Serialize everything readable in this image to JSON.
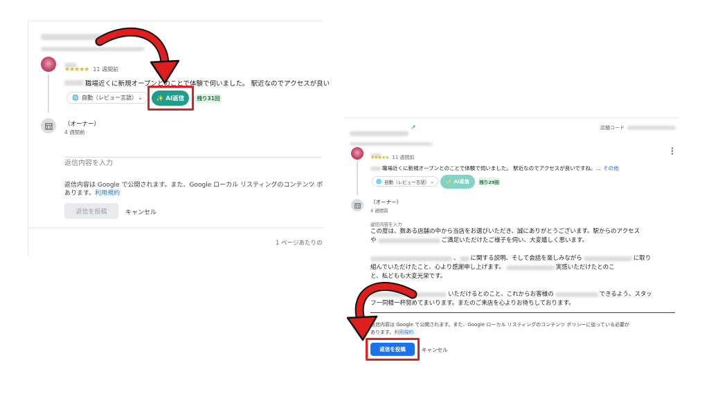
{
  "left_panel": {
    "stars": "★★★★★",
    "review_time": "11 週間前",
    "review_text": "職場近くに新規オープンとのことで体験で伺いました。 駅近なのでアクセスが良い",
    "lang_select": "自動（レビュー言語）",
    "ai_button": "✨ AI返信",
    "remaining": "残り31回",
    "owner_label": "（オーナー）",
    "owner_time": "4 週間前",
    "reply_placeholder": "返信内容を入力",
    "notice": "返信内容は Google で公開されます。また、Google ローカル リスティングのコンテンツ ポ",
    "notice_2": "あります。",
    "terms_link": "利用規約",
    "post_button": "返信を投稿",
    "cancel_button": "キャンセル",
    "pagination": "1 ページあたりの"
  },
  "right_panel": {
    "store_code_label": "店舗コード",
    "stars": "★★★★★",
    "review_time": "11 週間前",
    "review_text": "職場近くに新規オープンとのことで体験で伺いました。 駅近なのでアクセスが良いですね。…",
    "more_link": "その他",
    "lang_select": "自動（レビュー言語）",
    "ai_button": "✨ AI返信",
    "remaining": "残り29回",
    "owner_label": "（オーナー）",
    "owner_time": "4 週間前",
    "reply_label": "返信内容を入力",
    "reply_lines": [
      "この度は、数ある店舗の中から当店をお選びいただき、誠にありがとうございます。駅からのアクセス",
      "ご満足いただけたご様子を伺い、大変嬉しく思います。",
      "に関する説明、そして会話を楽しみながら",
      "に取り",
      "組んでいただけたこと、心より感謝申し上げます。",
      "実感いただけたとのこ",
      "と、私どもも大変光栄です。",
      "いただけるとのこと、これからお客様の",
      "できるよう、スタッ",
      "フ一同精一杯努めてまいります。またのご来店を心よりお待ちしております。"
    ],
    "reply_prefix_ya": "や",
    "reply_prefix_a": "、",
    "notice": "返信内容は Google で公開されます。また、Google ローカル リスティングのコンテンツ ポリシーに従っている必要が",
    "notice_2": "あります。",
    "terms_link": "利用規約",
    "post_button": "返信を投稿",
    "cancel_button": "キャンセル"
  },
  "colors": {
    "ai_teal": "#1e9e8a",
    "post_blue": "#1a73e8",
    "highlight_red": "#e01e1e"
  }
}
